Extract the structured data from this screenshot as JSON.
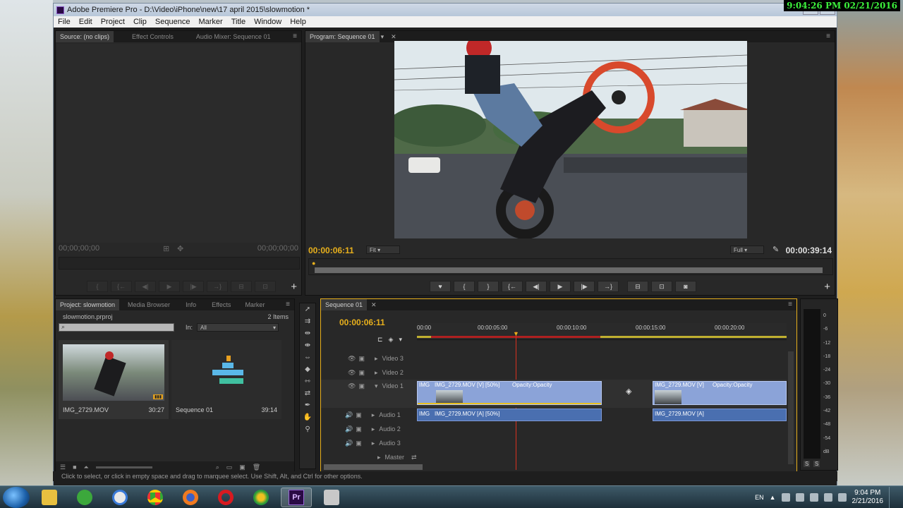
{
  "overlay_clock": "9:04:26 PM 02/21/2016",
  "window": {
    "title": "Adobe Premiere Pro - D:\\Video\\iPhone\\new\\17 april 2015\\slowmotion *",
    "menu": [
      "File",
      "Edit",
      "Project",
      "Clip",
      "Sequence",
      "Marker",
      "Title",
      "Window",
      "Help"
    ]
  },
  "source_panel": {
    "tabs": [
      "Source: (no clips)",
      "Effect Controls",
      "Audio Mixer: Sequence 01"
    ],
    "timecode_left": "00;00;00;00",
    "timecode_right": "00;00;00;00"
  },
  "program_panel": {
    "tab": "Program: Sequence 01",
    "timecode_current": "00:00:06:11",
    "fit": "Fit",
    "quality": "Full",
    "duration": "00:00:39:14"
  },
  "project_panel": {
    "tabs": [
      "Project: slowmotion",
      "Media Browser",
      "Info",
      "Effects",
      "Marker"
    ],
    "project_file": "slowmotion.prproj",
    "item_count": "2 Items",
    "search_placeholder": "",
    "in_label": "In:",
    "in_value": "All",
    "items": [
      {
        "name": "IMG_2729.MOV",
        "duration": "30:27"
      },
      {
        "name": "Sequence 01",
        "duration": "39:14"
      }
    ]
  },
  "timeline": {
    "tab": "Sequence 01",
    "timecode": "00:00:06:11",
    "ruler": [
      "00:00",
      "00:00:05:00",
      "00:00:10:00",
      "00:00:15:00",
      "00:00:20:00"
    ],
    "tracks": [
      "Video 3",
      "Video 2",
      "Video 1",
      "Audio 1",
      "Audio 2",
      "Audio 3",
      "Master"
    ],
    "clips": {
      "v1_a_short": "IMG",
      "v1_a_label": "IMG_2729.MOV [V] [50%]",
      "v1_a_fx": "Opacity:Opacity",
      "v1_b_label": "IMG_2729.MOV [V]",
      "v1_b_fx": "Opacity:Opacity",
      "a1_a_short": "IMG",
      "a1_a_label": "IMG_2729.MOV [A] [50%]",
      "a1_b_label": "IMG_2729.MOV [A]"
    }
  },
  "meter_labels": [
    "0",
    "-6",
    "-12",
    "-18",
    "-24",
    "-30",
    "-36",
    "-42",
    "-48",
    "-54",
    "dB"
  ],
  "meter_solo": [
    "S",
    "S"
  ],
  "status": "Click to select, or click in empty space and drag to marquee select. Use Shift, Alt, and Ctrl for other options.",
  "taskbar": {
    "lang": "EN",
    "time": "9:04 PM",
    "date": "2/21/2016",
    "active_app": "Pr"
  }
}
